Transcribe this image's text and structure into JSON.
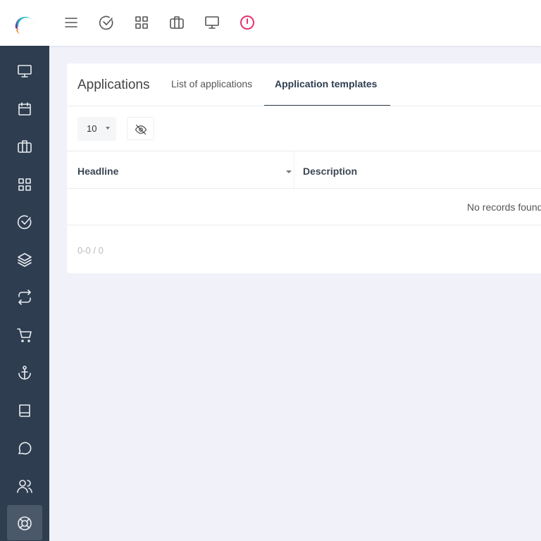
{
  "header": {
    "icons": [
      "menu-icon",
      "check-circle-icon",
      "grid-icon",
      "briefcase-icon",
      "monitor-icon",
      "power-alert-icon"
    ],
    "alert_color": "#e6336f"
  },
  "sidebar": {
    "items": [
      "monitor",
      "calendar",
      "briefcase",
      "grid",
      "check-circle",
      "layers",
      "repeat",
      "cart",
      "anchor",
      "book",
      "chat",
      "users",
      "lifebuoy"
    ],
    "active": "lifebuoy"
  },
  "page": {
    "title": "Applications",
    "tabs": [
      {
        "label": "List of applications"
      },
      {
        "label": "Application templates",
        "active": true
      }
    ]
  },
  "toolbar": {
    "page_size": "10"
  },
  "table": {
    "columns": [
      "Headline",
      "Description"
    ],
    "empty_text": "No records found"
  },
  "pager": {
    "text": "0-0 / 0"
  }
}
